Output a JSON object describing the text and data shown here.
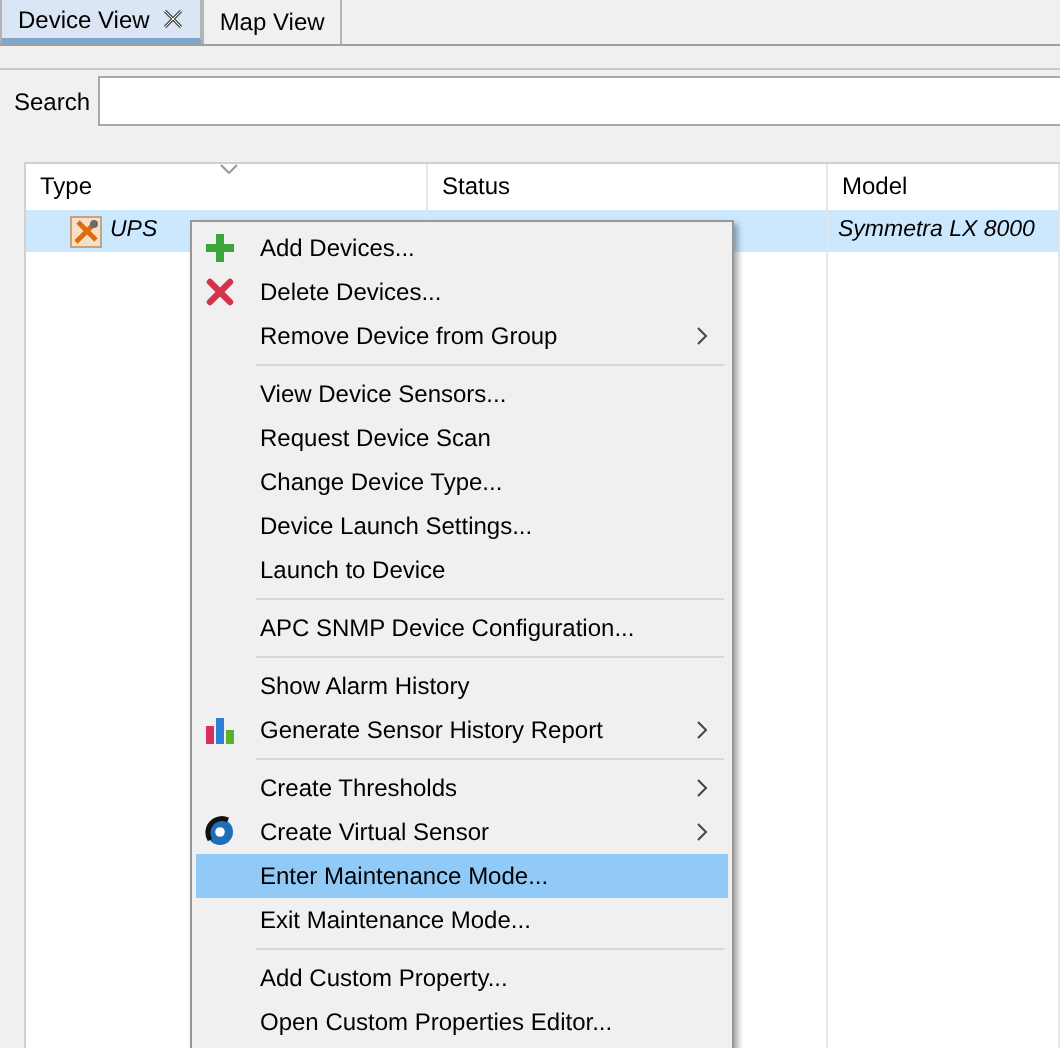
{
  "tabs": [
    {
      "label": "Device View",
      "selected": true,
      "closable": true
    },
    {
      "label": "Map View",
      "selected": false,
      "closable": false
    }
  ],
  "search": {
    "label": "Search"
  },
  "table": {
    "columns": [
      "Type",
      "Status",
      "Model"
    ],
    "rows": [
      {
        "type": "UPS",
        "model": "Symmetra LX 8000",
        "selected": true
      }
    ]
  },
  "context_menu": [
    {
      "kind": "add",
      "label": "Add Devices...",
      "submenu": false,
      "selected": false
    },
    {
      "kind": "delete",
      "label": "Delete Devices...",
      "submenu": false,
      "selected": false
    },
    {
      "kind": "plain",
      "label": "Remove Device from Group",
      "submenu": true,
      "selected": false
    },
    {
      "kind": "separator"
    },
    {
      "kind": "plain",
      "label": "View Device Sensors...",
      "submenu": false,
      "selected": false
    },
    {
      "kind": "plain",
      "label": "Request Device Scan",
      "submenu": false,
      "selected": false
    },
    {
      "kind": "plain",
      "label": "Change Device Type...",
      "submenu": false,
      "selected": false
    },
    {
      "kind": "plain",
      "label": "Device Launch Settings...",
      "submenu": false,
      "selected": false
    },
    {
      "kind": "plain",
      "label": "Launch to Device",
      "submenu": false,
      "selected": false
    },
    {
      "kind": "separator"
    },
    {
      "kind": "plain",
      "label": "APC SNMP Device Configuration...",
      "submenu": false,
      "selected": false
    },
    {
      "kind": "separator"
    },
    {
      "kind": "plain",
      "label": "Show Alarm History",
      "submenu": false,
      "selected": false
    },
    {
      "kind": "chart",
      "label": "Generate Sensor History Report",
      "submenu": true,
      "selected": false
    },
    {
      "kind": "separator"
    },
    {
      "kind": "plain",
      "label": "Create Thresholds",
      "submenu": true,
      "selected": false
    },
    {
      "kind": "sensor",
      "label": "Create Virtual Sensor",
      "submenu": true,
      "selected": false
    },
    {
      "kind": "plain",
      "label": "Enter Maintenance Mode...",
      "submenu": false,
      "selected": true
    },
    {
      "kind": "plain",
      "label": "Exit Maintenance Mode...",
      "submenu": false,
      "selected": false
    },
    {
      "kind": "separator"
    },
    {
      "kind": "plain",
      "label": "Add Custom Property...",
      "submenu": false,
      "selected": false
    },
    {
      "kind": "plain",
      "label": "Open Custom Properties Editor...",
      "submenu": false,
      "selected": false
    }
  ]
}
